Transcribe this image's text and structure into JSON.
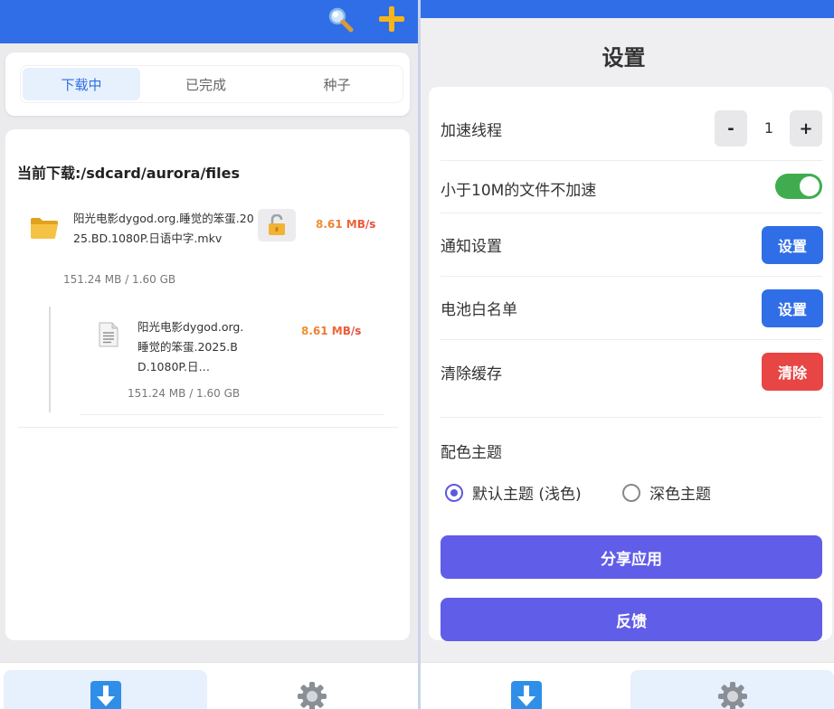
{
  "left": {
    "tabs": [
      {
        "label": "下载中"
      },
      {
        "label": "已完成"
      },
      {
        "label": "种子"
      }
    ],
    "download_path": "当前下载:/sdcard/aurora/files",
    "tasks": [
      {
        "title": "阳光电影dygod.org.睡觉的笨蛋.2025.BD.1080P.日语中字.mkv",
        "speed": "8.61 MB/s",
        "size": "151.24 MB / 1.60 GB",
        "files": [
          {
            "title": "阳光电影dygod.org.睡觉的笨蛋.2025.BD.1080P.日…",
            "speed": "8.61 MB/s",
            "size": "151.24 MB / 1.60 GB"
          }
        ]
      }
    ]
  },
  "right": {
    "title": "设置",
    "rows": {
      "threads": {
        "label": "加速线程",
        "minus": "-",
        "value": "1",
        "plus": "+"
      },
      "small_files": {
        "label": "小于10M的文件不加速",
        "enabled": true
      },
      "notify": {
        "label": "通知设置",
        "button": "设置"
      },
      "battery": {
        "label": "电池白名单",
        "button": "设置"
      },
      "cache": {
        "label": "清除缓存",
        "button": "清除"
      }
    },
    "theme": {
      "label": "配色主题",
      "options": [
        "默认主题 (浅色)",
        "深色主题"
      ],
      "selected": "默认主题 (浅色)"
    },
    "share_button": "分享应用",
    "feedback_button": "反馈"
  },
  "colors": {
    "accent": "#2f6ee6",
    "speed_orange": "#f0932b",
    "speed_red": "#e8473a",
    "danger": "#e84545",
    "primary_button": "#605de8",
    "toggle_on": "#3fad4f"
  },
  "icons": [
    "search-icon",
    "plus-icon",
    "folder-icon",
    "lock-icon",
    "document-icon",
    "download-icon",
    "gear-icon"
  ]
}
